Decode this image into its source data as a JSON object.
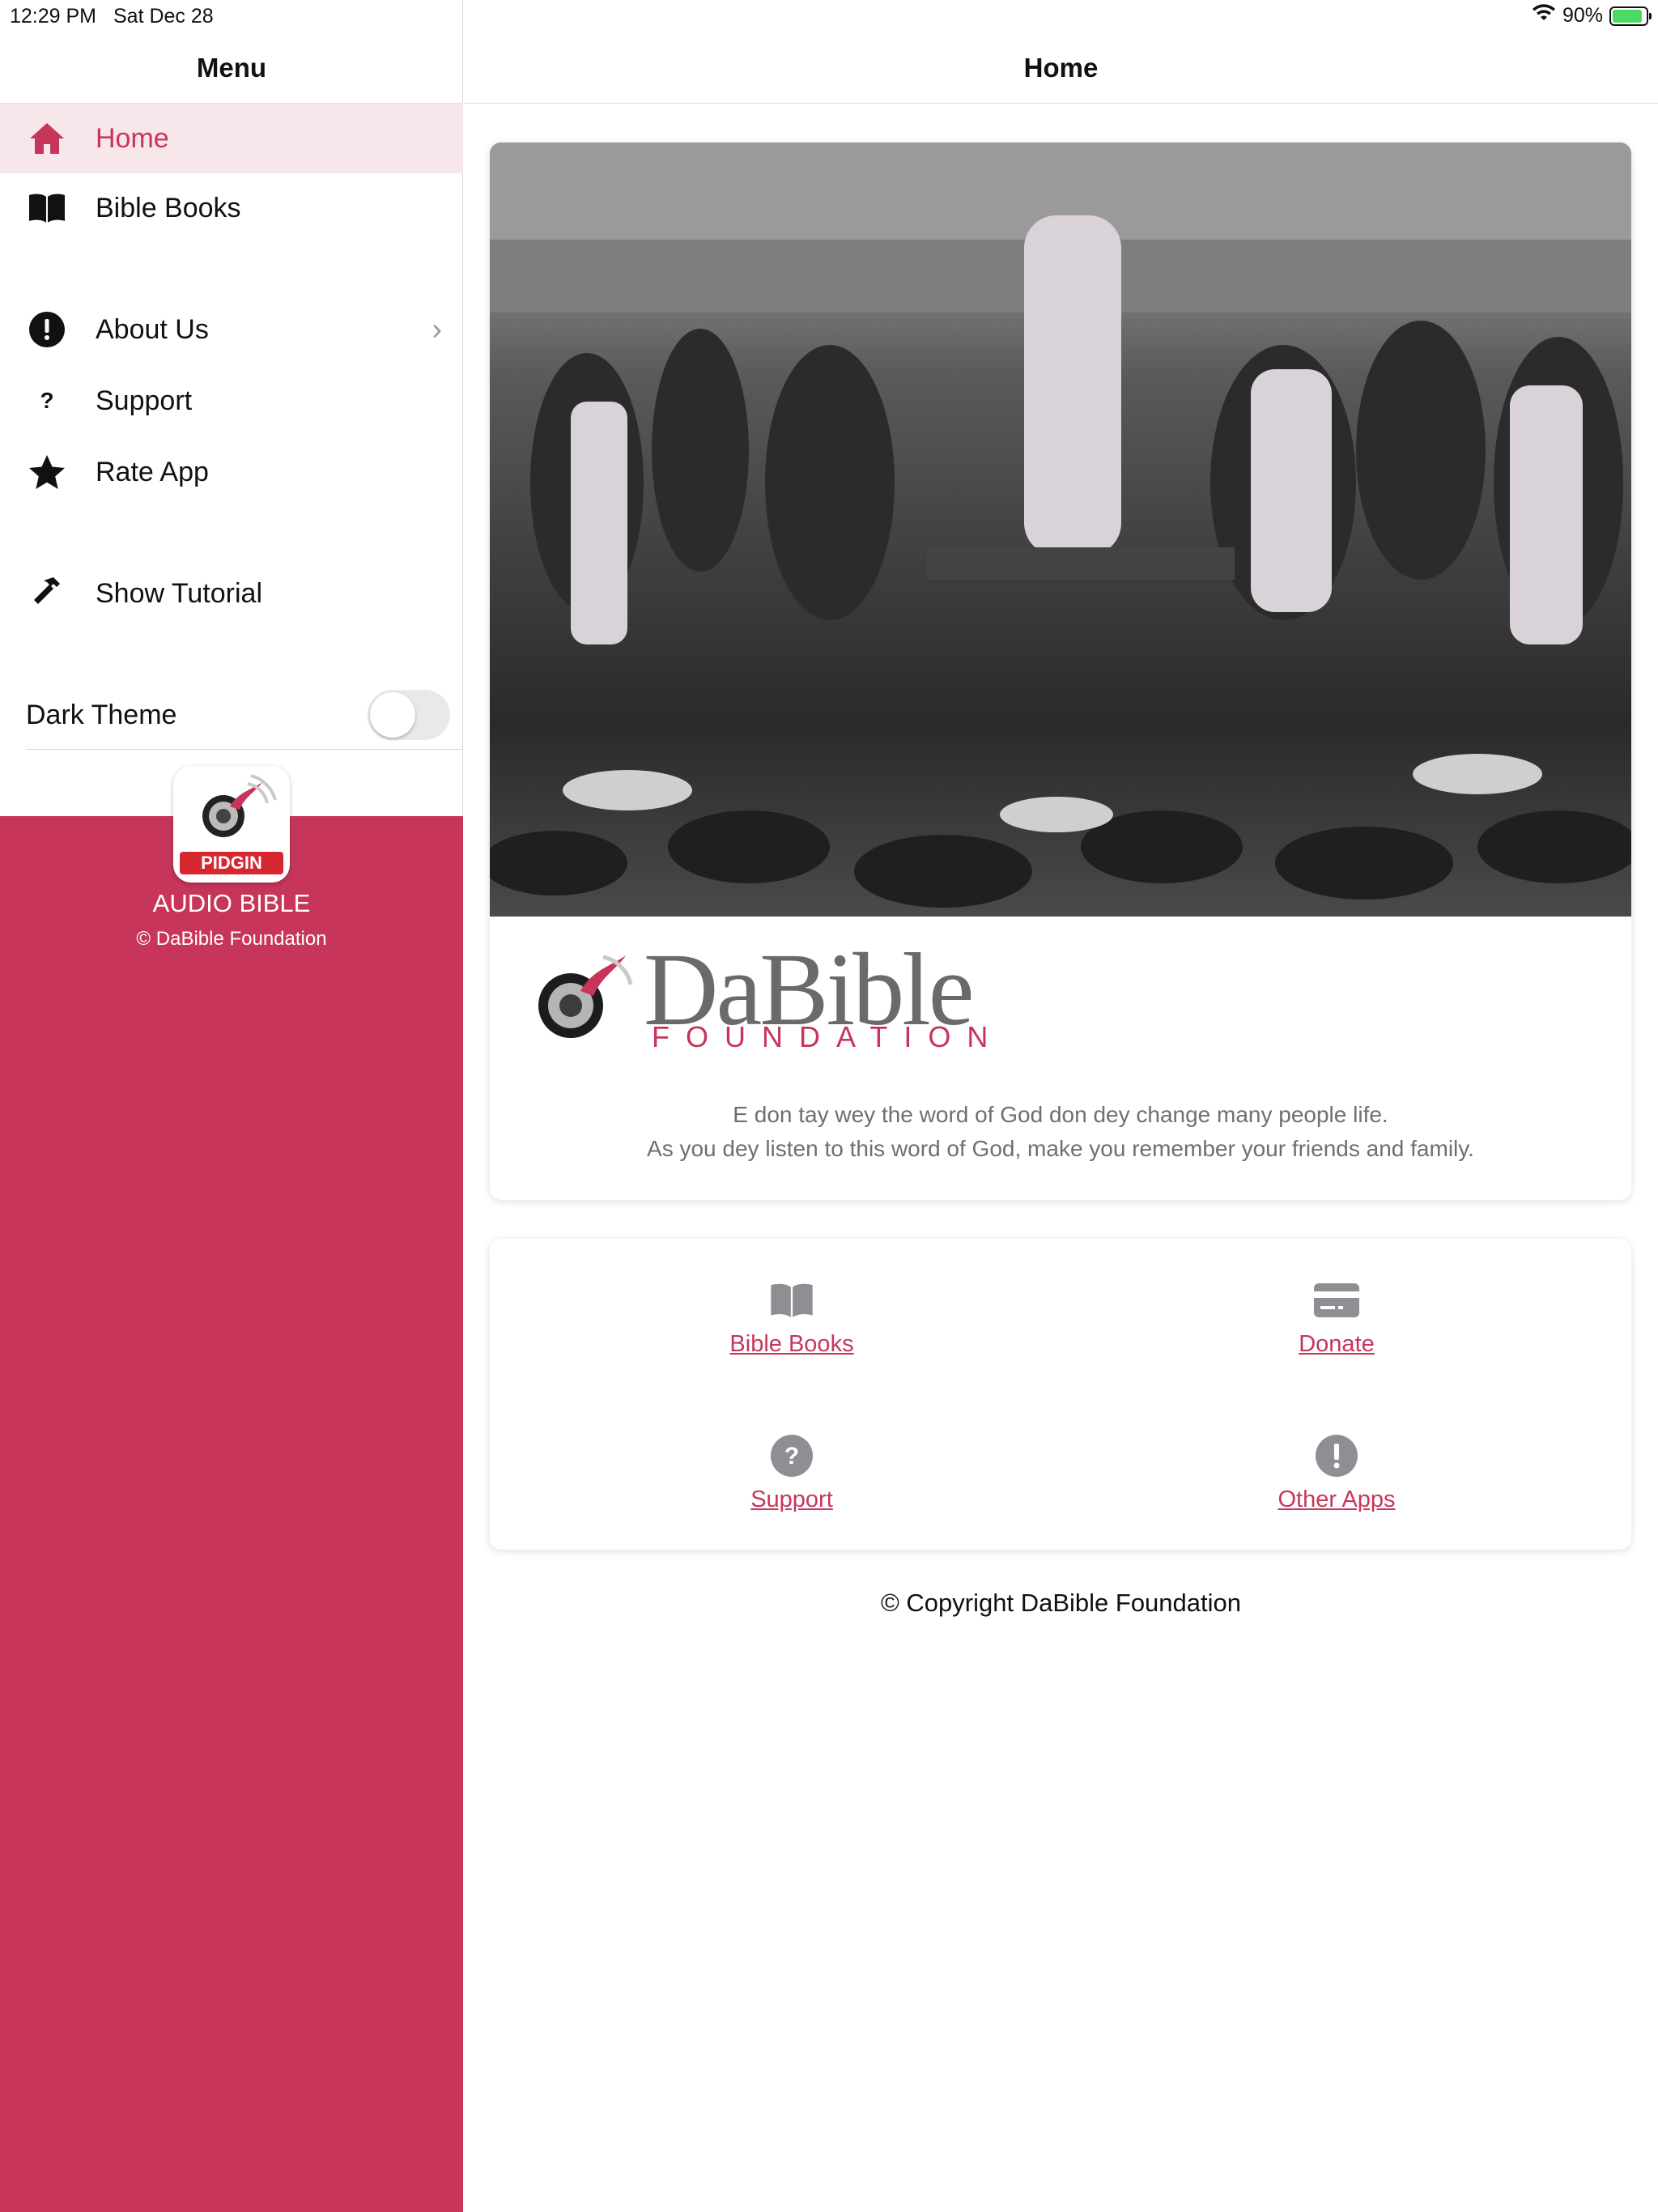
{
  "status_bar": {
    "time": "12:29 PM",
    "date": "Sat Dec 28",
    "battery": "90%",
    "battery_level": 0.9
  },
  "sidebar": {
    "title": "Menu",
    "items": [
      {
        "label": "Home",
        "icon": "home-icon",
        "active": true
      },
      {
        "label": "Bible Books",
        "icon": "book-icon"
      },
      {
        "label": "About Us",
        "icon": "exclamation-circle-icon",
        "chevron": true
      },
      {
        "label": "Support",
        "icon": "question-icon"
      },
      {
        "label": "Rate App",
        "icon": "star-icon"
      },
      {
        "label": "Show Tutorial",
        "icon": "hammer-icon"
      }
    ],
    "dark_theme": {
      "label": "Dark Theme",
      "enabled": false
    },
    "brand": {
      "badge": "PIDGIN",
      "title": "AUDIO BIBLE",
      "copyright": "© DaBible Foundation"
    },
    "brand_color": "#c7365a"
  },
  "main": {
    "title": "Home",
    "logo": {
      "name": "DaBible",
      "sub": "FOUNDATION"
    },
    "tagline": [
      "E don tay wey the word of God don dey change many people life.",
      "As you dey listen to this word of God, make you remember your friends and family."
    ],
    "links": [
      {
        "label": "Bible Books",
        "icon": "book-icon"
      },
      {
        "label": "Donate",
        "icon": "card-icon"
      },
      {
        "label": "Support",
        "icon": "question-circle-icon"
      },
      {
        "label": "Other Apps",
        "icon": "exclamation-circle-icon"
      }
    ],
    "footer": "© Copyright DaBible Foundation"
  }
}
